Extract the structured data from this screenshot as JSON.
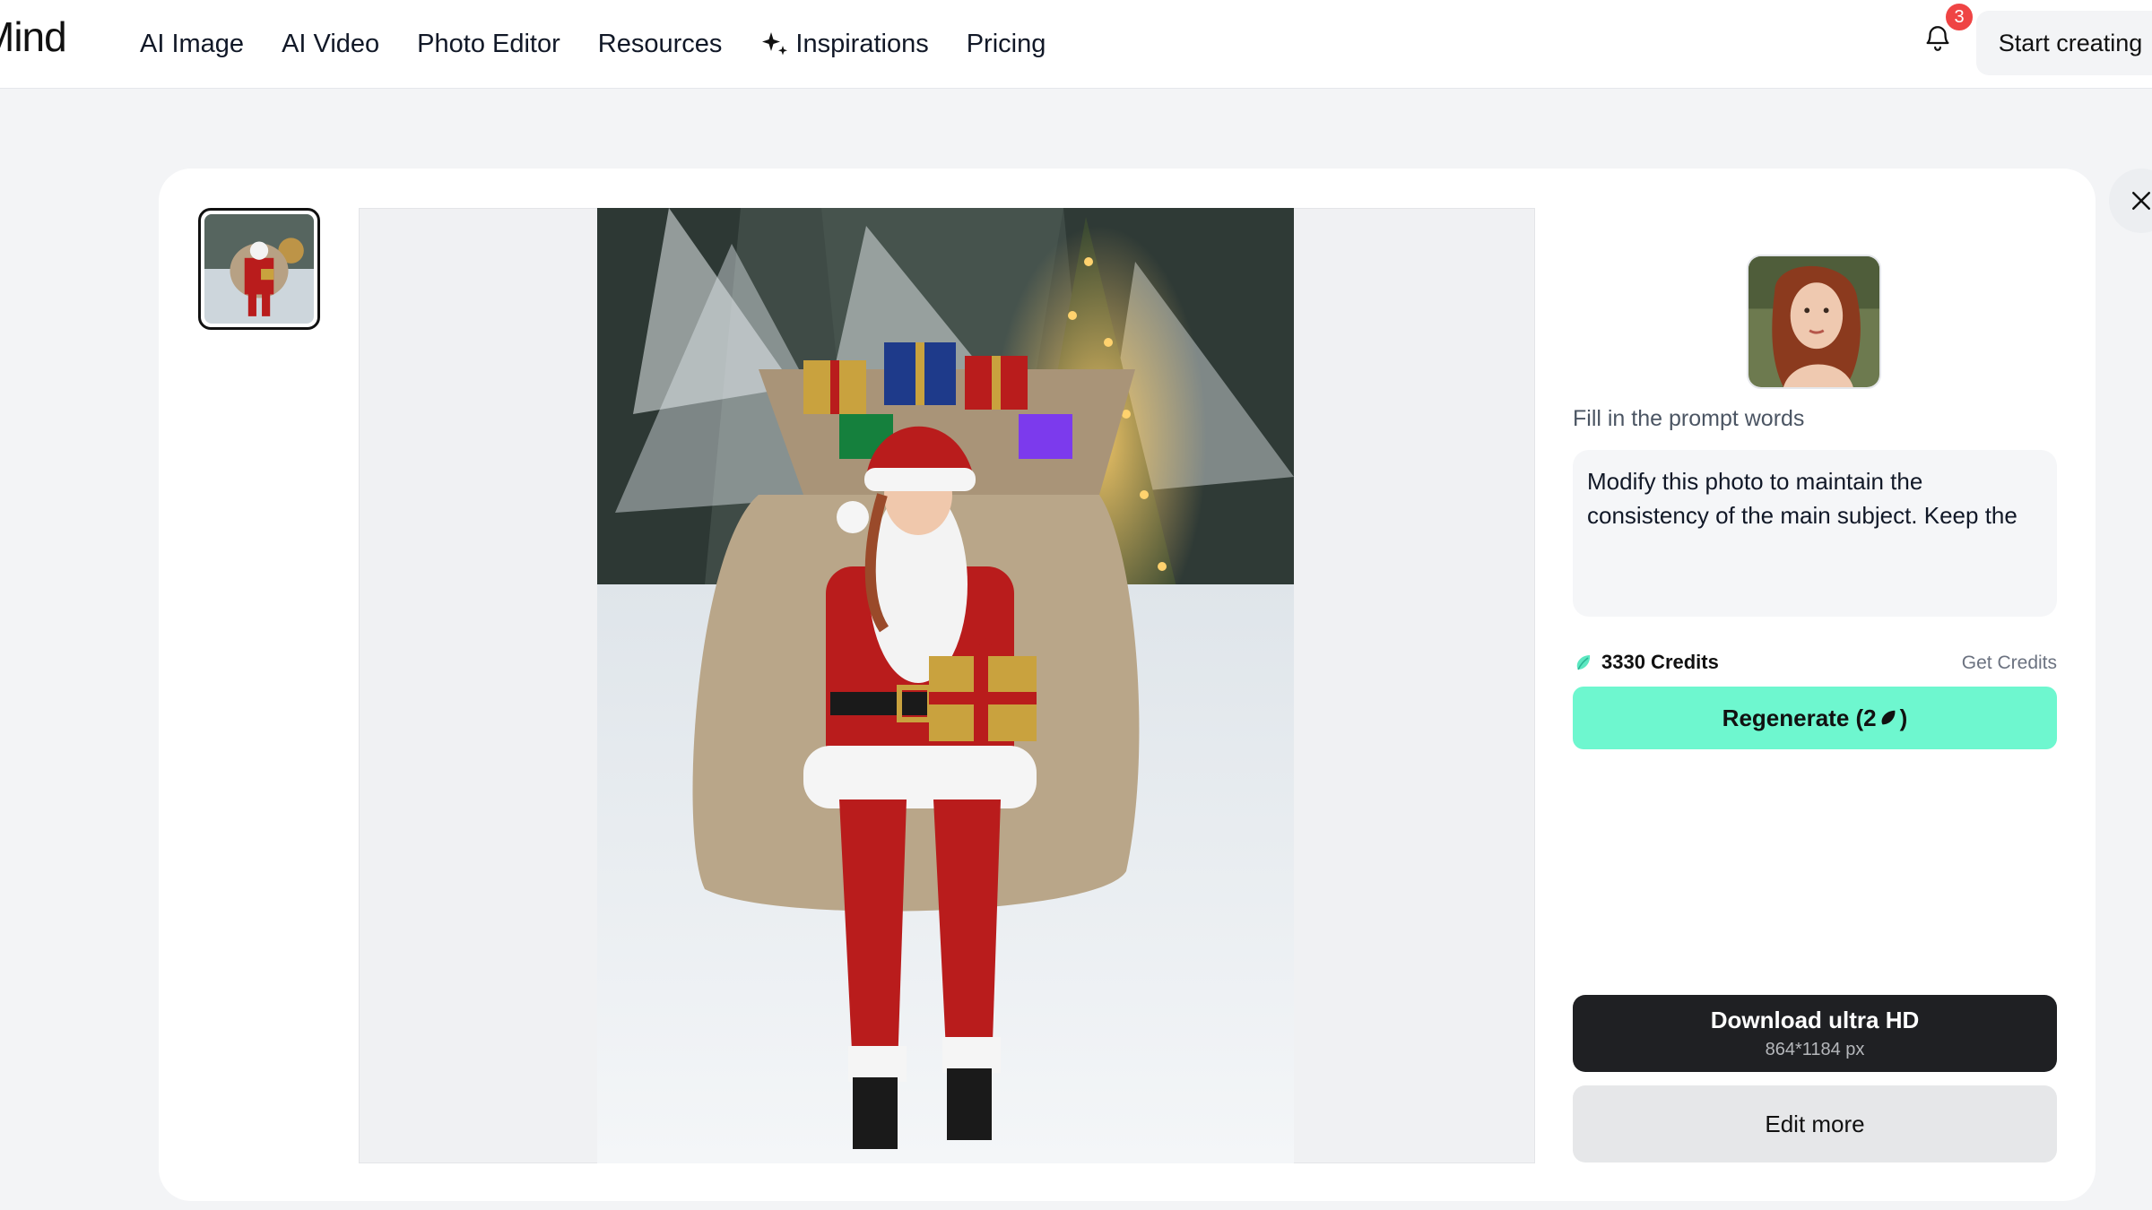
{
  "header": {
    "logo_text": "Mind",
    "nav": [
      {
        "label": "AI Image"
      },
      {
        "label": "AI Video"
      },
      {
        "label": "Photo Editor"
      },
      {
        "label": "Resources"
      },
      {
        "label": "Inspirations",
        "icon": "sparkle-icon"
      },
      {
        "label": "Pricing"
      }
    ],
    "notifications_count": "3",
    "start_label": "Start creating"
  },
  "panel": {
    "prompt_label": "Fill in the prompt words",
    "prompt_text": "Modify this photo to maintain the consistency of the main subject. Keep the",
    "credits_label": "3330 Credits",
    "get_credits_label": "Get Credits",
    "regen_prefix": "Regenerate (2",
    "regen_suffix": ")",
    "download_label": "Download ultra HD",
    "download_size": "864*1184 px",
    "edit_label": "Edit more"
  },
  "colors": {
    "accent": "#6ef7cf",
    "dark_button": "#1f2023",
    "badge": "#ef4444"
  }
}
